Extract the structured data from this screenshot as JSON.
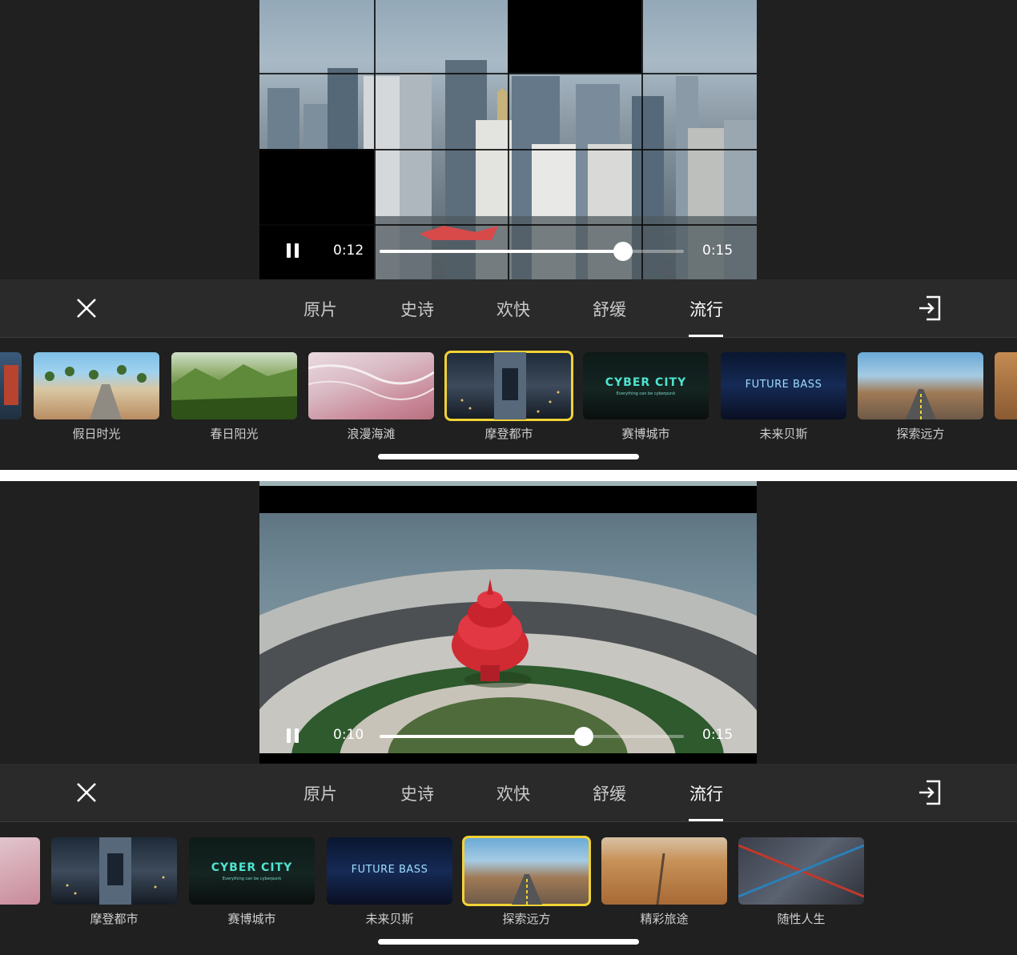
{
  "screens": [
    {
      "player": {
        "current_time": "0:12",
        "total_time": "0:15",
        "progress": 0.8
      },
      "tabs": [
        "原片",
        "史诗",
        "欢快",
        "舒缓",
        "流行"
      ],
      "active_tab": "流行",
      "themes": [
        {
          "label": "假日时光"
        },
        {
          "label": "春日阳光"
        },
        {
          "label": "浪漫海滩"
        },
        {
          "label": "摩登都市",
          "selected": true
        },
        {
          "label": "赛博城市",
          "overlay_title": "CYBER CITY",
          "overlay_sub": "Everything can be cyberpunk"
        },
        {
          "label": "未来贝斯",
          "overlay_title": "FUTURE BASS"
        },
        {
          "label": "探索远方"
        }
      ]
    },
    {
      "player": {
        "current_time": "0:10",
        "total_time": "0:15",
        "progress": 0.67
      },
      "tabs": [
        "原片",
        "史诗",
        "欢快",
        "舒缓",
        "流行"
      ],
      "active_tab": "流行",
      "themes": [
        {
          "label": "摩登都市"
        },
        {
          "label": "赛博城市",
          "overlay_title": "CYBER CITY",
          "overlay_sub": "Everything can be cyberpunk"
        },
        {
          "label": "未来贝斯",
          "overlay_title": "FUTURE BASS"
        },
        {
          "label": "探索远方",
          "selected": true
        },
        {
          "label": "精彩旅途"
        },
        {
          "label": "随性人生"
        }
      ]
    }
  ],
  "icons": {
    "close": "close-icon",
    "exit": "exit-icon",
    "pause": "pause-icon"
  },
  "colors": {
    "selection": "#f2d236",
    "panel_bg": "#202020",
    "tabbar_bg": "#2a2a2a"
  }
}
